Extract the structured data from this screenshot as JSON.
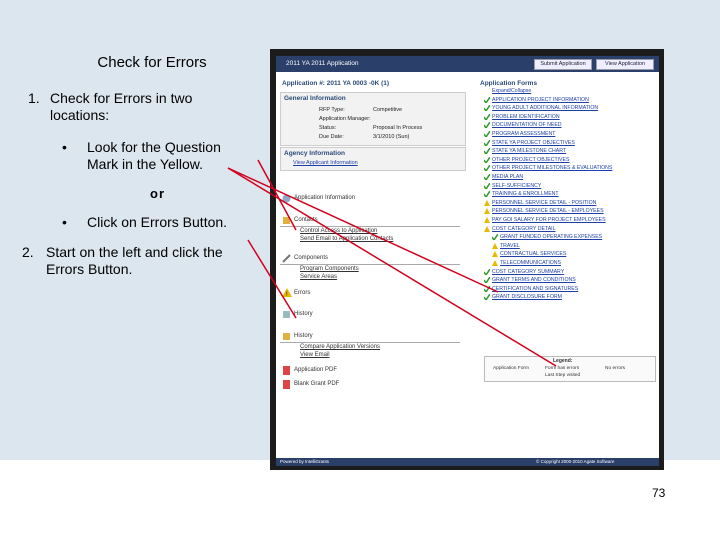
{
  "slide": {
    "title": "Check for Errors",
    "item1_num": "1.",
    "item1": "Check for Errors in two locations:",
    "bullet1": "Look for the Question Mark in the Yellow.",
    "or": "or",
    "bullet2": "Click on Errors Button.",
    "item2_num": "2.",
    "item2": "Start on the left and click the Errors Button.",
    "page": "73",
    "bullet_char": "•"
  },
  "app": {
    "header": "2011 YA 2011 Application",
    "submit_btn": "Submit Application",
    "view_btn": "View Application",
    "app_number": "Application #: 2011 YA 0003 -0K (1)",
    "general_info": "General Information",
    "rfp_type_label": "RFP Type:",
    "rfp_type": "Competitive",
    "manager_label": "Application Manager:",
    "status_label": "Status:",
    "status": "Proposal In Process",
    "due_label": "Due Date:",
    "due": "3/1/2010 (Sun)",
    "agency_info": "Agency Information",
    "view_agency": "View Applicant Information",
    "sections": [
      {
        "label": "Application Information"
      },
      {
        "label": "Contacts",
        "links": [
          "Control Access to Application",
          "Send Email to Application Contacts"
        ]
      },
      {
        "label": "Components",
        "links": [
          "Program Components",
          "Service Areas"
        ]
      },
      {
        "label": "Errors"
      },
      {
        "label": "History"
      },
      {
        "label": "History",
        "links": [
          "Compare Application Versions",
          "View Email"
        ]
      },
      {
        "label": "Application PDF"
      },
      {
        "label": "Blank Grant PDF"
      }
    ],
    "forms_title": "Application Forms",
    "forms": [
      "Expand/Collapse",
      "APPLICATION PROJECT INFORMATION",
      "YOUNG ADULT ADDITIONAL INFORMATION",
      "PROBLEM IDENTIFICATION",
      "DOCUMENTATION OF NEED",
      "PROGRAM ASSESSMENT",
      "STATE YA PROJECT OBJECTIVES",
      "STATE YA MILESTONE CHART",
      "OTHER PROJECT OBJECTIVES",
      "OTHER PROJECT MILESTONES & EVALUATIONS",
      "MEDIA PLAN",
      "SELF-SUFFICIENCY",
      "TRAINING & ENROLLMENT",
      "PERSONNEL SERVICE DETAIL - POSITION",
      "PERSONNEL SERVICE DETAIL - EMPLOYEES",
      "PAY GOI SALARY FOR PROJECT EMPLOYEES",
      "COST CATEGORY DETAIL",
      "GRANT FUNDED OPERATING EXPENSES",
      "TRAVEL",
      "CONTRACTUAL SERVICES",
      "TELECOMMUNICATIONS",
      "COST CATEGORY SUMMARY",
      "GRANT TERMS AND CONDITIONS",
      "CERTIFICATION AND SIGNATURES",
      "GRANT DISCLOSURE FORM"
    ],
    "legend_title": "Legend:",
    "legend_items": [
      "Application Form",
      "Form has errors",
      "No errors",
      "Last Step visited"
    ],
    "footer_left": "Powered by IntelliGrants",
    "footer_right": "© Copyright 2000-2010 Agate Software"
  },
  "colors": {
    "slide_bg": "#dce6ef",
    "app_blue": "#2a3f6a",
    "link": "#1e3fa8",
    "arrow": "#d1001c",
    "warn": "#e9b800",
    "ok": "#2c9a2c"
  }
}
